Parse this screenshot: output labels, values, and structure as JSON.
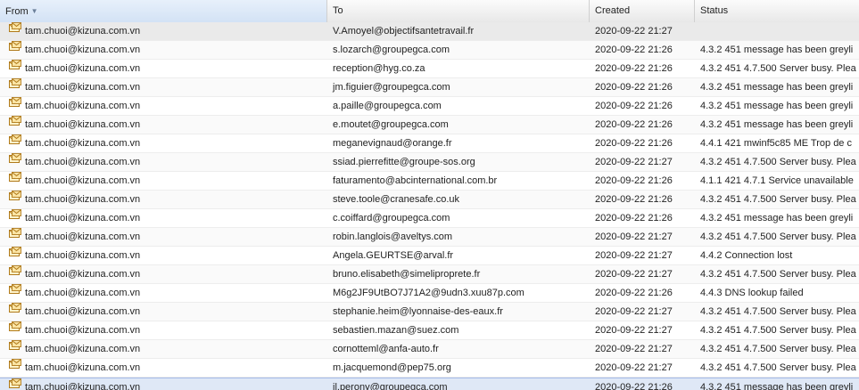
{
  "columns": {
    "from": "From",
    "to": "To",
    "created": "Created",
    "status": "Status"
  },
  "icon": "mail-queue-icon",
  "rows": [
    {
      "from": "tam.chuoi@kizuna.com.vn",
      "to": "V.Amoyel@objectifsantetravail.fr",
      "created": "2020-09-22 21:27",
      "status": ""
    },
    {
      "from": "tam.chuoi@kizuna.com.vn",
      "to": "s.lozarch@groupegca.com",
      "created": "2020-09-22 21:26",
      "status": "4.3.2 451 message has been greyli"
    },
    {
      "from": "tam.chuoi@kizuna.com.vn",
      "to": "reception@hyg.co.za",
      "created": "2020-09-22 21:26",
      "status": "4.3.2 451 4.7.500 Server busy. Plea"
    },
    {
      "from": "tam.chuoi@kizuna.com.vn",
      "to": "jm.figuier@groupegca.com",
      "created": "2020-09-22 21:26",
      "status": "4.3.2 451 message has been greyli"
    },
    {
      "from": "tam.chuoi@kizuna.com.vn",
      "to": "a.paille@groupegca.com",
      "created": "2020-09-22 21:26",
      "status": "4.3.2 451 message has been greyli"
    },
    {
      "from": "tam.chuoi@kizuna.com.vn",
      "to": "e.moutet@groupegca.com",
      "created": "2020-09-22 21:26",
      "status": "4.3.2 451 message has been greyli"
    },
    {
      "from": "tam.chuoi@kizuna.com.vn",
      "to": "meganevignaud@orange.fr",
      "created": "2020-09-22 21:26",
      "status": "4.4.1 421 mwinf5c85 ME Trop de c"
    },
    {
      "from": "tam.chuoi@kizuna.com.vn",
      "to": "ssiad.pierrefitte@groupe-sos.org",
      "created": "2020-09-22 21:27",
      "status": "4.3.2 451 4.7.500 Server busy. Plea"
    },
    {
      "from": "tam.chuoi@kizuna.com.vn",
      "to": "faturamento@abcinternational.com.br",
      "created": "2020-09-22 21:26",
      "status": "4.1.1 421 4.7.1 Service unavailable"
    },
    {
      "from": "tam.chuoi@kizuna.com.vn",
      "to": "steve.toole@cranesafe.co.uk",
      "created": "2020-09-22 21:26",
      "status": "4.3.2 451 4.7.500 Server busy. Plea"
    },
    {
      "from": "tam.chuoi@kizuna.com.vn",
      "to": "c.coiffard@groupegca.com",
      "created": "2020-09-22 21:26",
      "status": "4.3.2 451 message has been greyli"
    },
    {
      "from": "tam.chuoi@kizuna.com.vn",
      "to": "robin.langlois@aveltys.com",
      "created": "2020-09-22 21:27",
      "status": "4.3.2 451 4.7.500 Server busy. Plea"
    },
    {
      "from": "tam.chuoi@kizuna.com.vn",
      "to": "Angela.GEURTSE@arval.fr",
      "created": "2020-09-22 21:27",
      "status": "4.4.2 Connection lost"
    },
    {
      "from": "tam.chuoi@kizuna.com.vn",
      "to": "bruno.elisabeth@simeliproprete.fr",
      "created": "2020-09-22 21:27",
      "status": "4.3.2 451 4.7.500 Server busy. Plea"
    },
    {
      "from": "tam.chuoi@kizuna.com.vn",
      "to": "M6g2JF9UtBO7J71A2@9udn3.xuu87p.com",
      "created": "2020-09-22 21:26",
      "status": "4.4.3 DNS lookup failed"
    },
    {
      "from": "tam.chuoi@kizuna.com.vn",
      "to": "stephanie.heim@lyonnaise-des-eaux.fr",
      "created": "2020-09-22 21:27",
      "status": "4.3.2 451 4.7.500 Server busy. Plea"
    },
    {
      "from": "tam.chuoi@kizuna.com.vn",
      "to": "sebastien.mazan@suez.com",
      "created": "2020-09-22 21:27",
      "status": "4.3.2 451 4.7.500 Server busy. Plea"
    },
    {
      "from": "tam.chuoi@kizuna.com.vn",
      "to": "cornotteml@anfa-auto.fr",
      "created": "2020-09-22 21:27",
      "status": "4.3.2 451 4.7.500 Server busy. Plea"
    },
    {
      "from": "tam.chuoi@kizuna.com.vn",
      "to": "m.jacquemond@pep75.org",
      "created": "2020-09-22 21:27",
      "status": "4.3.2 451 4.7.500 Server busy. Plea"
    },
    {
      "from": "tam.chuoi@kizuna.com.vn",
      "to": "jl.perony@groupegca.com",
      "created": "2020-09-22 21:26",
      "status": "4.3.2 451 message has been greyli"
    }
  ]
}
